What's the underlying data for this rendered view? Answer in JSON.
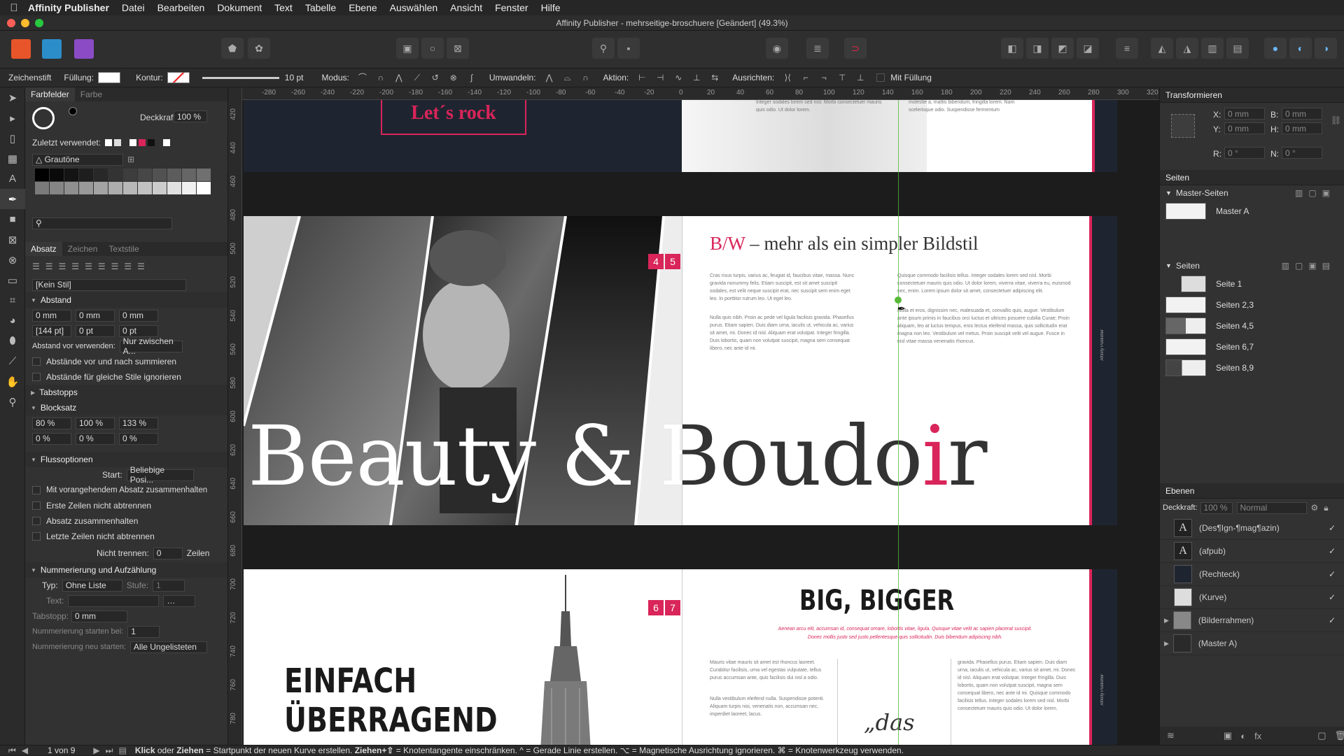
{
  "menubar": {
    "app": "Affinity Publisher",
    "items": [
      "Datei",
      "Bearbeiten",
      "Dokument",
      "Text",
      "Tabelle",
      "Ebene",
      "Auswählen",
      "Ansicht",
      "Fenster",
      "Hilfe"
    ]
  },
  "window": {
    "title": "Affinity Publisher - mehrseitige-broschuere [Geändert] (49.3%)"
  },
  "ctx": {
    "tool": "Zeichenstift",
    "fill": "Füllung:",
    "stroke": "Kontur:",
    "width": "10 pt",
    "mode": "Modus:",
    "convert": "Umwandeln:",
    "action": "Aktion:",
    "align": "Ausrichten:",
    "withfill": "Mit Füllung"
  },
  "left": {
    "tabs": [
      "Farbfelder",
      "Farbe"
    ],
    "opacity_label": "Deckkraft:",
    "opacity_value": "100 %",
    "recent": "Zuletzt verwendet:",
    "palette": "Grautöne",
    "para_tabs": [
      "Absatz",
      "Zeichen",
      "Textstile"
    ],
    "style": "[Kein Stil]",
    "spacing": "Abstand",
    "sp_vals": [
      "0 mm",
      "0 mm",
      "0 mm"
    ],
    "sp_vals2": [
      "[144 pt]",
      "0 pt",
      "0 pt"
    ],
    "space_before_label": "Abstand vor verwenden:",
    "space_before_value": "Nur zwischen A...",
    "cb1": "Abstände vor und nach summieren",
    "cb2": "Abstände für gleiche Stile ignorieren",
    "tabstops": "Tabstopps",
    "block": "Blocksatz",
    "block_vals": [
      "80 %",
      "100 %",
      "133 %"
    ],
    "block_vals2": [
      "0 %",
      "0 %",
      "0 %"
    ],
    "flow": "Flussoptionen",
    "start_label": "Start:",
    "start_value": "Beliebige Posi...",
    "flow_cbs": [
      "Mit vorangehendem Absatz zusammenhalten",
      "Erste Zeilen nicht abtrennen",
      "Absatz zusammenhalten",
      "Letzte Zeilen nicht abtrennen"
    ],
    "keep_label": "Nicht trennen:",
    "keep_value": "0",
    "keep_unit": "Zeilen",
    "numbering": "Nummerierung und Aufzählung",
    "type_label": "Typ:",
    "type_value": "Ohne Liste",
    "level_label": "Stufe:",
    "level_value": "1",
    "text_label": "Text:",
    "tabstop_label": "Tabstopp:",
    "tabstop_value": "0 mm",
    "numstart_label": "Nummerierung starten bei:",
    "numstart_value": "1",
    "numrestart_label": "Nummerierung neu starten:",
    "numrestart_value": "Alle Ungelisteten"
  },
  "ruler_h": [
    "-280",
    "-260",
    "-240",
    "-220",
    "-200",
    "-180",
    "-160",
    "-140",
    "-120",
    "-100",
    "-80",
    "-60",
    "-40",
    "-20",
    "0",
    "20",
    "40",
    "60",
    "80",
    "100",
    "120",
    "140",
    "160",
    "180",
    "200",
    "220",
    "240",
    "260",
    "280",
    "300",
    "320"
  ],
  "ruler_v": [
    "420",
    "440",
    "460",
    "480",
    "500",
    "520",
    "540",
    "560",
    "580",
    "600",
    "620",
    "640",
    "660",
    "680",
    "700",
    "720",
    "740",
    "760",
    "780"
  ],
  "doc": {
    "lets_rock": "Let´s rock",
    "top_text": "Integer sodales lorem sed nisl. Morbi consectetuer mauris quis odio. Ut dolor lorem.",
    "top_text2": "molestie a, mattis bibendum, fringilla lorem. Nam scelerisque odio. Suspendisse fermentum",
    "pg1": "4",
    "pg2": "5",
    "bw": "B/W",
    "bw_rest": "– mehr als ein simpler Bildstil",
    "col1a": "Cras risus turpis, varius ac, feugiat id, faucibus vitae, massa. Nunc gravida nonummy felis. Etiam suscipit, est sit amet suscipit sodales, est velit neque suscipit erat, nec suscipit sem enim eget leo. In porttitor rutrum leo. Ut eget leo.",
    "col1b": "Nulla quis nibh. Proin ac pede vel ligula facilisis gravida. Phasellus purus. Etiam sapien. Duis diam urna, iaculis ut, vehicula ac, varius sit amet, mi. Donec id nisl. Aliquam erat volutpat. Integer fringilla. Duis lobortis, quam non volutpat suscipit, magna sem consequat libero, nec ante id mi.",
    "col2a": "Quisque commodo facilisis tellus. Integer sodales lorem sed nisl. Morbi consectetuer mauris quis odio. Ut dolor lorem, viverra vitae, viverra eu, euismod nec, enim. Lorem ipsum dolor sit amet, consectetuer adipiscing elit.",
    "col2b": "Nulla et eros, dignissim nec, malesuada et, convallis quis, augue. Vestibulum ante ipsum primis in faucibus orci luctus et ultrices posuere cubilia Curae; Proin aliquam, leo at luctus tempus, eros lectus eleifend massa, quis sollicitudin erat magna non leo. Vestibulum vel metus. Proin suscipit velit vel augue. Fusce in nisl vitae massa venenatis rhoncus.",
    "big_word_a": "Beauty & Boudo",
    "big_word_i": "i",
    "big_word_r": "r",
    "side_text": "Affinity Publisher",
    "pg3": "6",
    "pg4": "7",
    "big": "BIG, BIGGER",
    "big_sub": "Aenean arcu elit, accumsan id, consequat ornare, lobortis vitae, ligula. Quisque vitae velit ac sapien placerat suscipit. Donec mollis justo sed justo pellentesque quis sollicitudin. Duis bibendum adipiscing nibh.",
    "col3": "Mauris vitae mauris sit amet est rhoncus laoreet. Curabitur facilisis, urna vel egestas vulputate, tellus purus accumsan ante, quis facilisis dui nisl a odio.",
    "col3b": "Nulla vestibulum eleifend nulla. Suspendisse potenti. Aliquam turpis nisi, venenatis non, accumsan nec, imperdiet laoreet, lacus.",
    "col4": "gravida. Phasellus purus. Etiam sapien. Duis diam urna, iaculis ut, vehicula ac, varius sit amet, mi. Donec id nisl. Aliquam erat volutpat. Integer fringilla. Duis lobortis, quam non volutpat suscipit, magna sem consequat libero, nec ante id mi. Quisque commodo facilisis tellus. Integer sodales lorem sed nisl. Morbi consectetuer mauris quis odio. Ut dolor lorem.",
    "einfach": "EINFACH",
    "ueberragend": "ÜBERRAGEND",
    "quote": "„das"
  },
  "right": {
    "transform": "Transformieren",
    "x_label": "X:",
    "x": "0 mm",
    "y_label": "Y:",
    "y": "0 mm",
    "b_label": "B:",
    "b": "0 mm",
    "h_label": "H:",
    "h": "0 mm",
    "r_label": "R:",
    "r": "0 °",
    "n_label": "N:",
    "n": "0 °",
    "pages": "Seiten",
    "master_pages": "Master-Seiten",
    "master_a": "Master A",
    "pages_sub": "Seiten",
    "page_list": [
      "Seite 1",
      "Seiten 2,3",
      "Seiten 4,5",
      "Seiten 6,7",
      "Seiten 8,9"
    ],
    "layers": "Ebenen",
    "layer_opacity_label": "Deckkraft:",
    "layer_opacity": "100 %",
    "blend": "Normal",
    "layer_list": [
      "(Des¶Ign-¶mag¶azin)",
      "(afpub)",
      "(Rechteck)",
      "(Kurve)",
      "(Bilderrahmen)",
      "(Master A)"
    ]
  },
  "status": {
    "page": "1 von 9",
    "hint_b1": "Klick",
    "hint_t1": "oder",
    "hint_b2": "Ziehen",
    "hint_t2": "= Startpunkt der neuen Kurve erstellen.",
    "hint_b3": "Ziehen+⇧",
    "hint_t3": "= Knotentangente einschränken. ^ = Gerade Linie erstellen. ⌥ = Magnetische Ausrichtung ignorieren. ⌘ = Knotenwerkzeug verwenden."
  },
  "colors": {
    "accent": "#d9255a",
    "dark": "#1f2530",
    "guide": "#58b83a"
  }
}
